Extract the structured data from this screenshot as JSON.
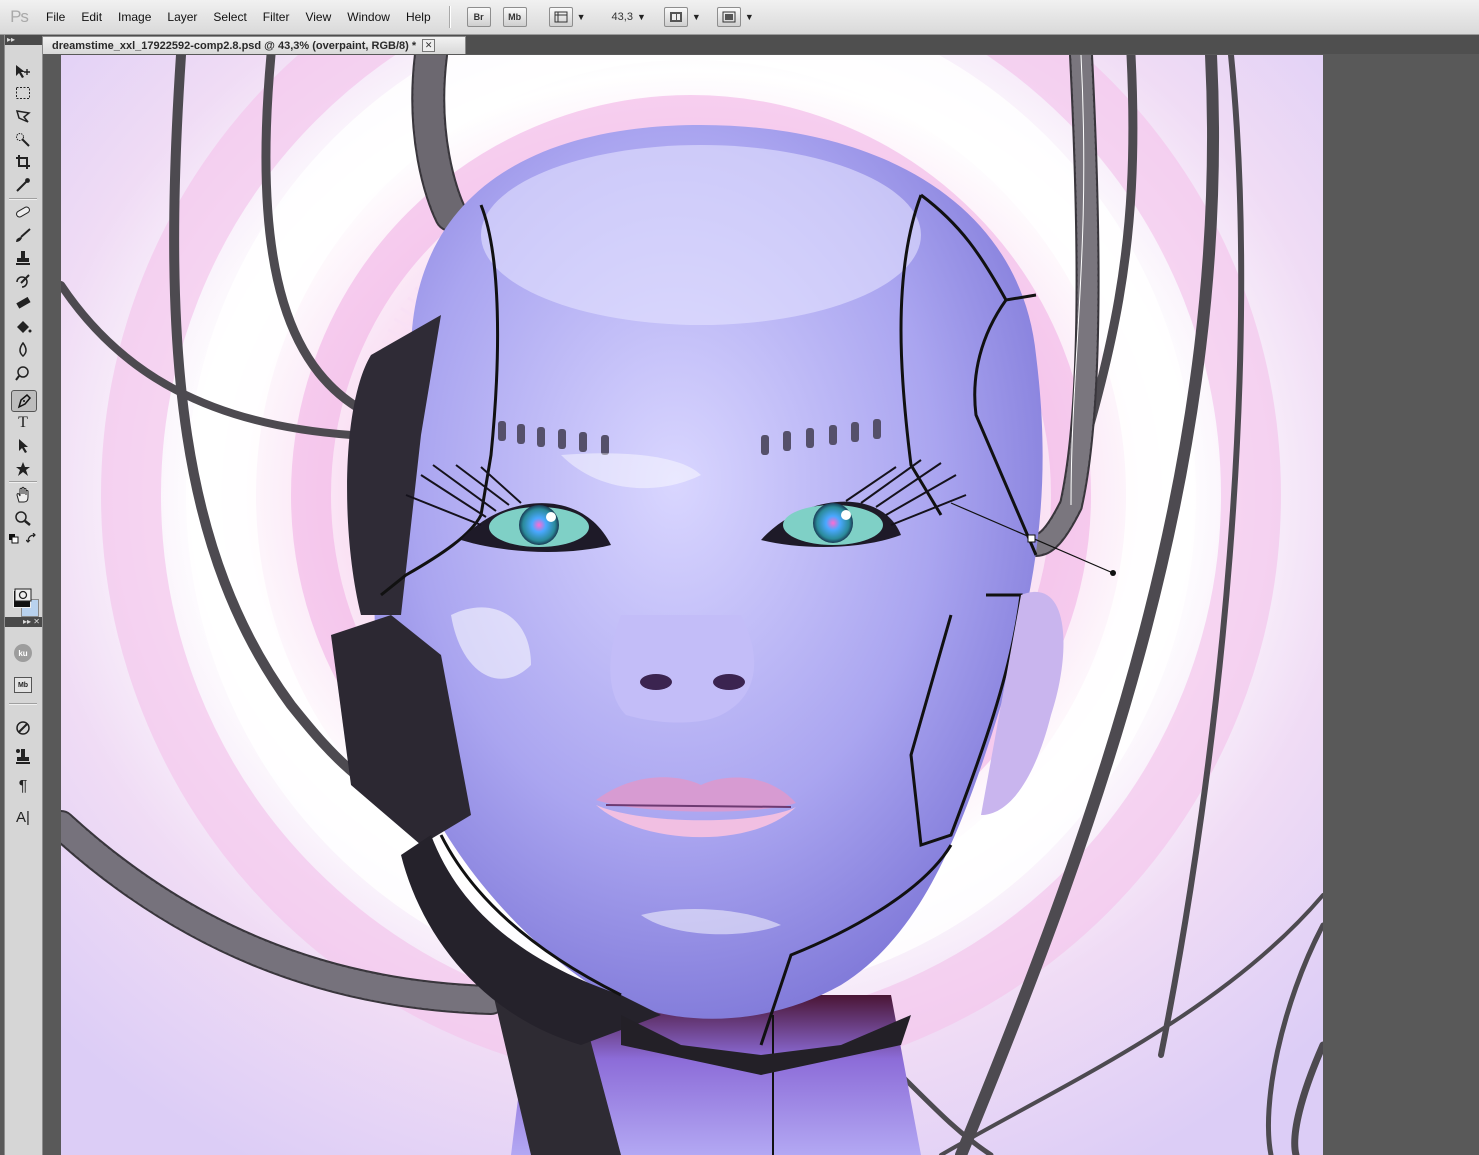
{
  "app": {
    "logo": "Ps"
  },
  "menu": [
    "File",
    "Edit",
    "Image",
    "Layer",
    "Select",
    "Filter",
    "View",
    "Window",
    "Help"
  ],
  "toolbar": {
    "bridge_label": "Br",
    "minibridge_label": "Mb",
    "zoom_value": "43,3"
  },
  "document": {
    "tab_title": "dreamstime_xxl_17922592-comp2.8.psd @ 43,3% (overpaint, RGB/8) *",
    "close_glyph": "✕"
  },
  "tools": {
    "panel_labels": [
      "ku",
      "Mb"
    ],
    "type_tool_glyph": "T",
    "paragraph_glyph": "¶",
    "character_glyph": "A|"
  },
  "colors": {
    "foreground": "#111111",
    "background": "#b9d2ee",
    "canvas_bg": "#f3e6f7",
    "face": "#b8b3f3"
  }
}
